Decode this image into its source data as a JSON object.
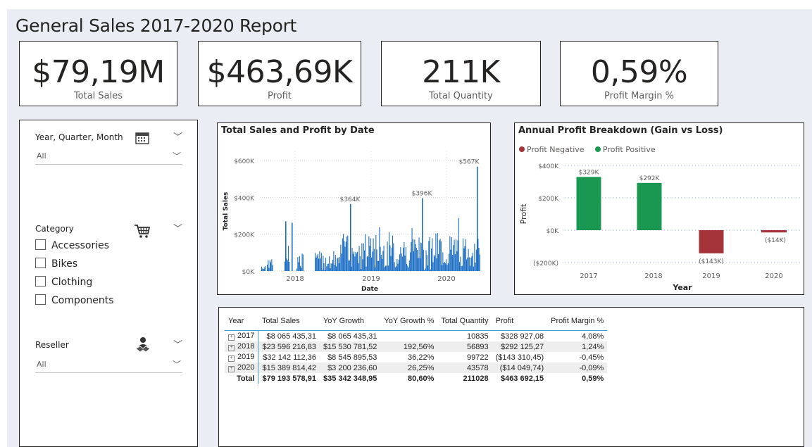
{
  "report": {
    "title": "General Sales 2017-2020 Report"
  },
  "kpis": [
    {
      "value": "$79,19M",
      "label": "Total Sales"
    },
    {
      "value": "$463,69K",
      "label": "Profit"
    },
    {
      "value": "211K",
      "label": "Total Quantity"
    },
    {
      "value": "0,59%",
      "label": "Profit Margin %"
    }
  ],
  "slicers": {
    "date": {
      "title": "Year, Quarter, Month",
      "value": "All",
      "icon": "calendar-icon"
    },
    "category": {
      "title": "Category",
      "icon": "shopping-cart-icon",
      "options": [
        "Accessories",
        "Bikes",
        "Clothing",
        "Components"
      ]
    },
    "reseller": {
      "title": "Reseller",
      "value": "All",
      "icon": "handshake-person-icon"
    }
  },
  "chart_data": [
    {
      "type": "bar",
      "title": "Total Sales and Profit by Date",
      "xlabel": "Date",
      "ylabel": "Total Sales",
      "yticks": [
        "$0K",
        "$200K",
        "$400K",
        "$600K"
      ],
      "xticks": [
        "2018",
        "2019",
        "2020"
      ],
      "ylim": [
        0,
        650000
      ],
      "color": "#1f6fc5",
      "peak_labels": [
        "$364K",
        "$396K",
        "$567K"
      ],
      "grid": true
    },
    {
      "type": "bar",
      "title": "Annual Profit Breakdown (Gain vs Loss)",
      "xlabel": "Year",
      "ylabel": "Profit",
      "legend": [
        {
          "name": "Profit Negative",
          "color": "#a4343a"
        },
        {
          "name": "Profit Positive",
          "color": "#1a9851"
        }
      ],
      "legend_position": "top-left",
      "categories": [
        "2017",
        "2018",
        "2019",
        "2020"
      ],
      "values": [
        329,
        292,
        -143,
        -14
      ],
      "data_labels": [
        "$329K",
        "$292K",
        "($143K)",
        "($14K)"
      ],
      "yticks": [
        "$400K",
        "$200K",
        "$0K",
        "($200K)"
      ],
      "ylim": [
        -200,
        400
      ],
      "grid": true
    }
  ],
  "table": {
    "headers": [
      "Year",
      "Total Sales",
      "YoY Growth",
      "YoY Growth %",
      "Total Quantity",
      "Profit",
      "Profit Margin %"
    ],
    "rows": [
      [
        "2017",
        "$8 065 435,31",
        "$8 065 435,31",
        "",
        "10835",
        "$328 927,08",
        "4,08%"
      ],
      [
        "2018",
        "$23 596 216,83",
        "$15 530 781,52",
        "192,56%",
        "56893",
        "$292 125,27",
        "1,24%"
      ],
      [
        "2019",
        "$32 142 112,36",
        "$8 545 895,53",
        "36,22%",
        "99722",
        "($143 310,45)",
        "-0,45%"
      ],
      [
        "2020",
        "$15 389 814,42",
        "$3 200 236,60",
        "26,25%",
        "43578",
        "($14 049,74)",
        "-0,09%"
      ]
    ],
    "total": [
      "Total",
      "$79 193 578,91",
      "$35 342 348,95",
      "80,60%",
      "211028",
      "$463 692,15",
      "0,59%"
    ]
  }
}
